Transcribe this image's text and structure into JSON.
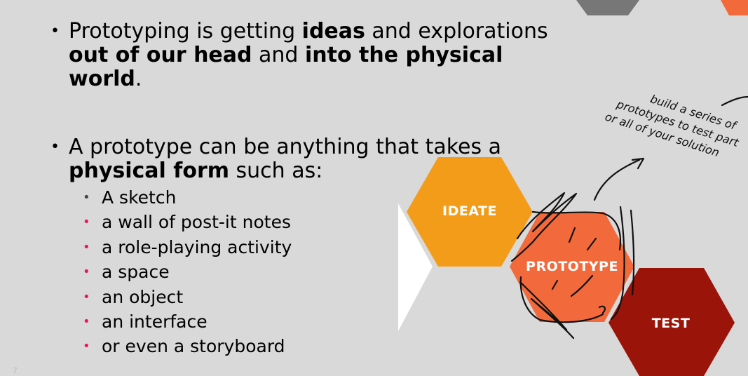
{
  "bullets": {
    "b1": {
      "line1_a": "Prototyping is getting ",
      "line1_b": "ideas",
      "line1_c": " and explorations",
      "line2_a": "out of our head",
      "line2_b": " and ",
      "line2_c": "into the physical",
      "line3_a": "world",
      "line3_b": "."
    },
    "b2": {
      "line1": "A prototype can be anything that takes a",
      "line2_a": "physical form",
      "line2_b": " such as:"
    },
    "marker": "•"
  },
  "examples": [
    "A sketch",
    "a wall of post-it notes",
    "a role-playing activity",
    "a space",
    "an object",
    "an interface",
    "or even a storyboard"
  ],
  "diagram": {
    "ideate": "IDEATE",
    "prototype": "PROTOTYPE",
    "test": "TEST",
    "note_line1": "build a series of",
    "note_line2": "prototypes to test part",
    "note_line3": "or all of your solution",
    "colors": {
      "ideate": "#f39c1a",
      "prototype": "#f26a3c",
      "test": "#9a1409",
      "top_grey": "#777777",
      "top_orange": "#f26a3c"
    }
  },
  "page_number": "7"
}
